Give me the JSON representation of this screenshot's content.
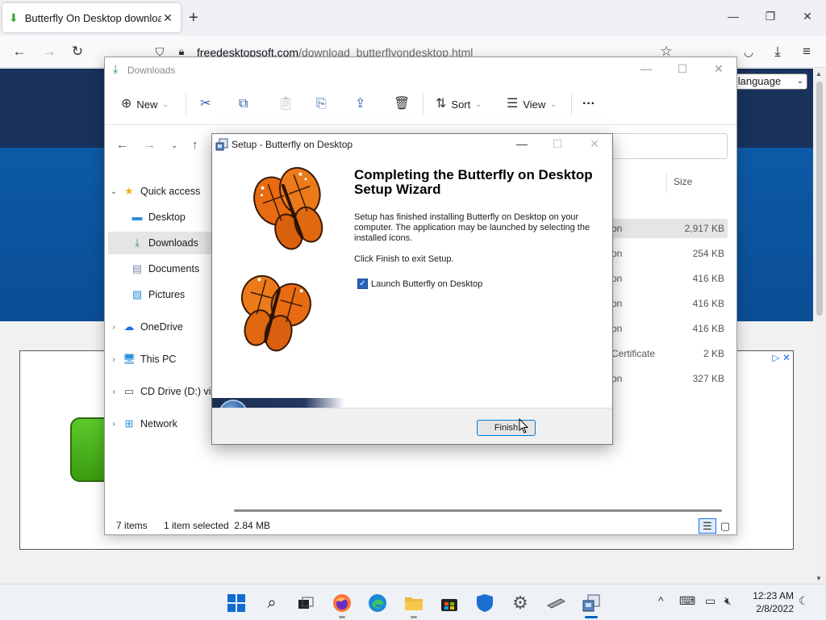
{
  "browser": {
    "tab_title": "Butterfly On Desktop download",
    "tab_close": "✕",
    "new_tab": "+",
    "url_domain": "freedesktopsoft.com",
    "url_path": "/download_butterflyondesktop.html"
  },
  "webpage": {
    "language_select": "ct language"
  },
  "explorer": {
    "title": "Downloads",
    "toolbar": {
      "new_label": "New",
      "sort_label": "Sort",
      "view_label": "View",
      "more_label": "···"
    },
    "nav": [
      {
        "label": "Quick access",
        "icon": "star-icon",
        "expandable": true,
        "expanded": true
      },
      {
        "label": "Desktop",
        "icon": "desktop-folder-icon"
      },
      {
        "label": "Downloads",
        "icon": "downloads-folder-icon",
        "selected": true
      },
      {
        "label": "Documents",
        "icon": "documents-folder-icon"
      },
      {
        "label": "Pictures",
        "icon": "pictures-folder-icon"
      },
      {
        "label": "OneDrive",
        "icon": "onedrive-icon",
        "expandable": true
      },
      {
        "label": "This PC",
        "icon": "this-pc-icon",
        "expandable": true
      },
      {
        "label": "CD Drive (D:) vi",
        "icon": "cd-drive-icon",
        "expandable": true
      },
      {
        "label": "Network",
        "icon": "network-icon",
        "expandable": true
      }
    ],
    "columns": {
      "size": "Size"
    },
    "files": [
      {
        "name_fragment": "on",
        "size": "2,917 KB",
        "selected": true
      },
      {
        "name_fragment": "on",
        "size": "254 KB"
      },
      {
        "name_fragment": "on",
        "size": "416 KB"
      },
      {
        "name_fragment": "on",
        "size": "416 KB"
      },
      {
        "name_fragment": "on",
        "size": "416 KB"
      },
      {
        "name_fragment": "Certificate",
        "size": "2 KB"
      },
      {
        "name_fragment": "on",
        "size": "327 KB"
      }
    ],
    "status": {
      "item_count": "7 items",
      "selection": "1 item selected  2.84 MB"
    }
  },
  "setup": {
    "title": "Setup - Butterfly on Desktop",
    "heading": "Completing the Butterfly on Desktop Setup Wizard",
    "description": "Setup has finished installing Butterfly on Desktop on your computer. The application may be launched by selecting the installed icons.",
    "exit_text": "Click Finish to exit Setup.",
    "launch_label": "Launch Butterfly on Desktop",
    "launch_checked": true,
    "finish_label": "Finish",
    "check_glyph": "✓"
  },
  "taskbar": {
    "apps": [
      "start-icon",
      "search-icon",
      "task-view-icon",
      "firefox-icon",
      "edge-icon",
      "file-explorer-icon",
      "store-icon",
      "security-icon",
      "settings-icon",
      "drive-icon",
      "setup-icon"
    ],
    "time": "12:23 AM",
    "date": "2/8/2022"
  },
  "colors": {
    "accent": "#0067c0",
    "page_navy": "#18325c",
    "page_blue": "#0d5aa6",
    "butterfly_orange": "#e86b12"
  }
}
